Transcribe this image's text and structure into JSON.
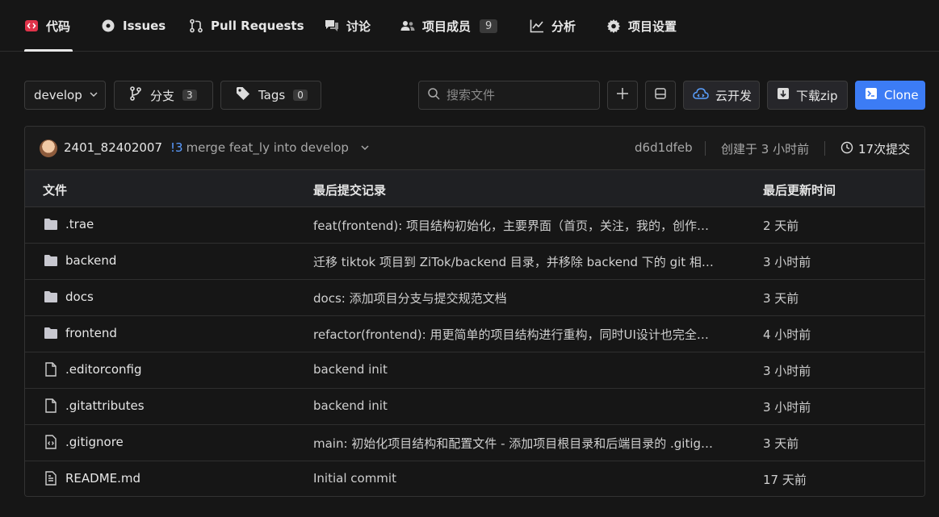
{
  "tabs": [
    {
      "label": "代码",
      "icon": "code-icon",
      "active": true
    },
    {
      "label": "Issues",
      "icon": "issue-circle-icon"
    },
    {
      "label": "Pull Requests",
      "icon": "pull-request-icon"
    },
    {
      "label": "讨论",
      "icon": "discussion-icon"
    },
    {
      "label": "项目成员",
      "icon": "members-icon",
      "badge": "9"
    },
    {
      "label": "分析",
      "icon": "chart-icon"
    },
    {
      "label": "项目设置",
      "icon": "gear-icon"
    }
  ],
  "toolbar": {
    "branch_selector": "develop",
    "branches_label": "分支",
    "branches_count": "3",
    "tags_label": "Tags",
    "tags_count": "0",
    "search_placeholder": "搜索文件",
    "cloud_dev_label": "云开发",
    "download_label": "下载zip",
    "clone_label": "Clone"
  },
  "commit": {
    "author": "2401_82402007",
    "pr_ref": "!3",
    "message": "merge feat_ly into develop",
    "sha": "d6d1dfeb",
    "created": "创建于 3 小时前",
    "commits": "17次提交"
  },
  "table": {
    "headers": {
      "file": "文件",
      "last_commit": "最后提交记录",
      "updated": "最后更新时间"
    },
    "rows": [
      {
        "type": "folder",
        "name": ".trae",
        "message": "feat(frontend): 项目结构初始化，主要界面（首页，关注，我的，创作…",
        "time": "2 天前"
      },
      {
        "type": "folder",
        "name": "backend",
        "message": "迁移 tiktok 项目到 ZiTok/backend 目录，并移除 backend 下的 git 相…",
        "time": "3 小时前"
      },
      {
        "type": "folder",
        "name": "docs",
        "message": "docs: 添加项目分支与提交规范文档",
        "time": "3 天前"
      },
      {
        "type": "folder",
        "name": "frontend",
        "message": "refactor(frontend): 用更简单的项目结构进行重构，同时UI设计也完全…",
        "time": "4 小时前"
      },
      {
        "type": "file",
        "name": ".editorconfig",
        "message": "backend init",
        "time": "3 小时前"
      },
      {
        "type": "file",
        "name": ".gitattributes",
        "message": "backend init",
        "time": "3 小时前"
      },
      {
        "type": "code-file",
        "name": ".gitignore",
        "message": "main: 初始化项目结构和配置文件 - 添加项目根目录和后端目录的 .gitig…",
        "time": "3 天前"
      },
      {
        "type": "doc-file",
        "name": "README.md",
        "message": "Initial commit",
        "time": "17 天前"
      }
    ]
  },
  "colors": {
    "accent": "#3c7cf5",
    "code_tab_icon": "#e0334a",
    "pr_link": "#5a9bff"
  }
}
